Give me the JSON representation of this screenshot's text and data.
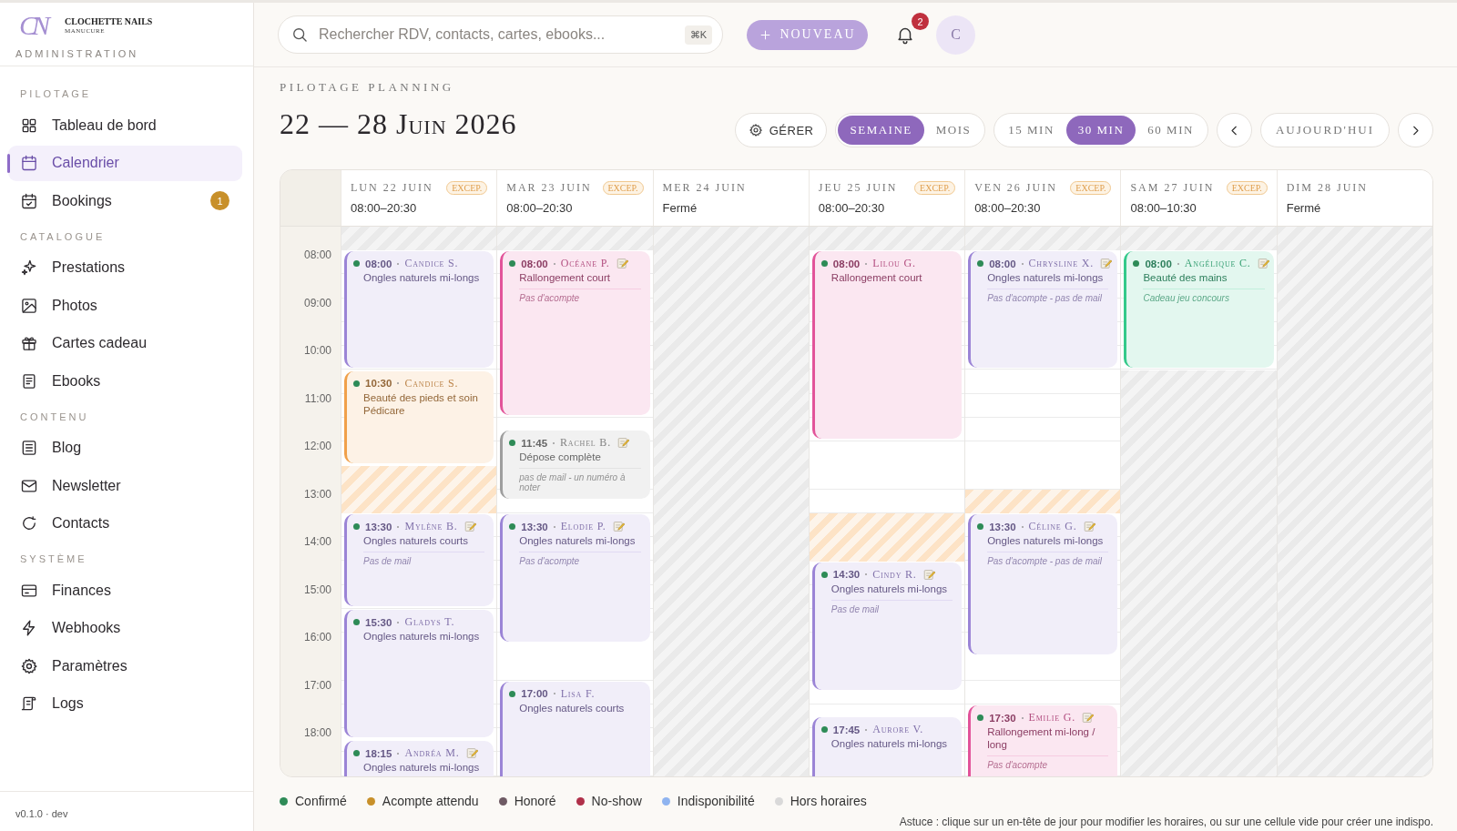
{
  "sidebar": {
    "logo": {
      "monogram": "CN",
      "brand": "CLOCHETTE NAILS",
      "tagline": "MANUCURE"
    },
    "subtitle": "ADMINISTRATION",
    "sections": [
      {
        "title": "PILOTAGE",
        "items": [
          {
            "label": "Tableau de bord",
            "selected": false
          },
          {
            "label": "Calendrier",
            "selected": true
          },
          {
            "label": "Bookings",
            "selected": false,
            "badge": "1"
          }
        ]
      },
      {
        "title": "CATALOGUE",
        "items": [
          {
            "label": "Prestations",
            "selected": false
          },
          {
            "label": "Photos",
            "selected": false
          },
          {
            "label": "Cartes cadeau",
            "selected": false
          },
          {
            "label": "Ebooks",
            "selected": false
          }
        ]
      },
      {
        "title": "CONTENU",
        "items": [
          {
            "label": "Blog",
            "selected": false
          },
          {
            "label": "Newsletter",
            "selected": false
          },
          {
            "label": "Contacts",
            "selected": false
          }
        ]
      },
      {
        "title": "SYSTÈME",
        "items": [
          {
            "label": "Finances",
            "selected": false
          },
          {
            "label": "Webhooks",
            "selected": false
          },
          {
            "label": "Paramètres",
            "selected": false
          },
          {
            "label": "Logs",
            "selected": false
          }
        ]
      }
    ],
    "version": "v0.1.0 · dev"
  },
  "topbar": {
    "search": {
      "placeholder": "Rechercher RDV, contacts, cartes, ebooks...",
      "shortcut": "⌘K"
    },
    "new_button": "NOUVEAU",
    "notifications": {
      "count": "2"
    },
    "avatar": "C"
  },
  "header": {
    "eyebrow": "PILOTAGE PLANNING",
    "title": "22 — 28 Juin 2026",
    "manage_button": "GÉRER",
    "views": [
      {
        "label": "SEMAINE",
        "selected": true
      },
      {
        "label": "MOIS",
        "selected": false
      }
    ],
    "steps": [
      {
        "label": "15 MIN",
        "selected": false
      },
      {
        "label": "30 MIN",
        "selected": true
      },
      {
        "label": "60 MIN",
        "selected": false
      }
    ],
    "today_button": "AUJOURD'HUI"
  },
  "calendar": {
    "hours": [
      "08:00",
      "09:00",
      "10:00",
      "11:00",
      "12:00",
      "13:00",
      "14:00",
      "15:00",
      "16:00",
      "17:00",
      "18:00"
    ],
    "days": [
      {
        "label": "LUN 22 JUIN",
        "hours": "08:00–20:30",
        "closed": false,
        "badge": "EXCEP.",
        "slots": [
          {
            "kind": "off"
          },
          {
            "kind": "event",
            "time": "08:00",
            "client": "Candice S.",
            "service": "Ongles naturels mi-longs",
            "confirmed": true,
            "color": "#9b84d6",
            "has_note": false
          },
          {
            "kind": "event",
            "time": "10:30",
            "client": "Candice S.",
            "service": "Beauté des pieds et soin Pédicare",
            "confirmed": true,
            "color": "#f0a04b",
            "has_note": false
          },
          {
            "kind": "break"
          },
          {
            "kind": "event",
            "time": "13:30",
            "client": "Mylène B.",
            "service": "Ongles naturels courts",
            "confirmed": true,
            "color": "#9b84d6",
            "has_note": true,
            "comment": "Pas de mail"
          },
          {
            "kind": "event",
            "time": "15:30",
            "client": "Gladys T.",
            "service": "Ongles naturels mi-longs",
            "confirmed": true,
            "color": "#9b84d6",
            "has_note": false
          },
          {
            "kind": "event",
            "time": "18:15",
            "client": "Andréa M.",
            "service": "Ongles naturels mi-longs",
            "confirmed": true,
            "color": "#9b84d6",
            "has_note": true
          }
        ]
      },
      {
        "label": "MAR 23 JUIN",
        "hours": "08:00–20:30",
        "closed": false,
        "badge": "EXCEP.",
        "slots": [
          {
            "kind": "off"
          },
          {
            "kind": "event",
            "time": "08:00",
            "client": "Océane P.",
            "service": "Rallongement court",
            "confirmed": true,
            "color": "#e2549a",
            "has_note": true,
            "comment": "Pas d'acompte"
          },
          {
            "kind": "event",
            "time": "11:45",
            "client": "Rachel B.",
            "service": "Dépose complète",
            "confirmed": true,
            "color": "#9e9e9e",
            "has_note": true,
            "comment": "pas de mail - un numéro à noter"
          },
          {
            "kind": "event",
            "time": "13:30",
            "client": "Elodie P.",
            "service": "Ongles naturels mi-longs",
            "confirmed": true,
            "color": "#9b84d6",
            "has_note": true,
            "comment": "Pas d'acompte"
          },
          {
            "kind": "event",
            "time": "17:00",
            "client": "Lisa F.",
            "service": "Ongles naturels courts",
            "confirmed": true,
            "color": "#9b84d6",
            "has_note": false
          }
        ]
      },
      {
        "label": "MER 24 JUIN",
        "hours": "Fermé",
        "closed": true
      },
      {
        "label": "JEU 25 JUIN",
        "hours": "08:00–20:30",
        "closed": false,
        "badge": "EXCEP.",
        "slots": [
          {
            "kind": "off"
          },
          {
            "kind": "event",
            "time": "08:00",
            "client": "Lilou G.",
            "service": "Rallongement court",
            "confirmed": true,
            "color": "#e2549a",
            "has_note": false
          },
          {
            "kind": "break"
          },
          {
            "kind": "event",
            "time": "14:30",
            "client": "Cindy R.",
            "service": "Ongles naturels mi-longs",
            "confirmed": true,
            "color": "#9b84d6",
            "has_note": true,
            "comment": "Pas de mail"
          },
          {
            "kind": "event",
            "time": "17:45",
            "client": "Aurore V.",
            "service": "Ongles naturels mi-longs",
            "confirmed": true,
            "color": "#9b84d6",
            "has_note": false
          }
        ]
      },
      {
        "label": "VEN 26 JUIN",
        "hours": "08:00–20:30",
        "closed": false,
        "badge": "EXCEP.",
        "slots": [
          {
            "kind": "off"
          },
          {
            "kind": "event",
            "time": "08:00",
            "client": "Chrysline X.",
            "service": "Ongles naturels mi-longs",
            "confirmed": true,
            "color": "#9b84d6",
            "has_note": true,
            "comment": "Pas d'acompte - pas de mail"
          },
          {
            "kind": "break"
          },
          {
            "kind": "event",
            "time": "13:30",
            "client": "Céline G.",
            "service": "Ongles naturels mi-longs",
            "confirmed": true,
            "color": "#9b84d6",
            "has_note": true,
            "comment": "Pas d'acompte - pas de mail"
          },
          {
            "kind": "event",
            "time": "17:30",
            "client": "Emilie G.",
            "service": "Rallongement mi-long / long",
            "confirmed": true,
            "color": "#e2549a",
            "has_note": true,
            "comment": "Pas d'acompte"
          }
        ]
      },
      {
        "label": "SAM 27 JUIN",
        "hours": "08:00–10:30",
        "closed": false,
        "badge": "EXCEP.",
        "slots": [
          {
            "kind": "off"
          },
          {
            "kind": "event",
            "time": "08:00",
            "client": "Angélique C.",
            "service": "Beauté des mains",
            "confirmed": true,
            "color": "#34c98a",
            "has_note": true,
            "comment": "Cadeau jeu concours"
          },
          {
            "kind": "off"
          }
        ]
      },
      {
        "label": "DIM 28 JUIN",
        "hours": "Fermé",
        "closed": true
      }
    ]
  },
  "legend": [
    {
      "label": "Confirmé",
      "color": "#2e8b57"
    },
    {
      "label": "Acompte attendu",
      "color": "#c8902a"
    },
    {
      "label": "Honoré",
      "color": "#6e5a64"
    },
    {
      "label": "No-show",
      "color": "#b0304a"
    },
    {
      "label": "Indisponibilité",
      "color": "#8fb4f0"
    },
    {
      "label": "Hors horaires",
      "color": "#d9d9d9"
    }
  ],
  "tip": "Astuce : clique sur un en-tête de jour pour modifier les horaires, ou sur une cellule vide pour créer une indispo."
}
